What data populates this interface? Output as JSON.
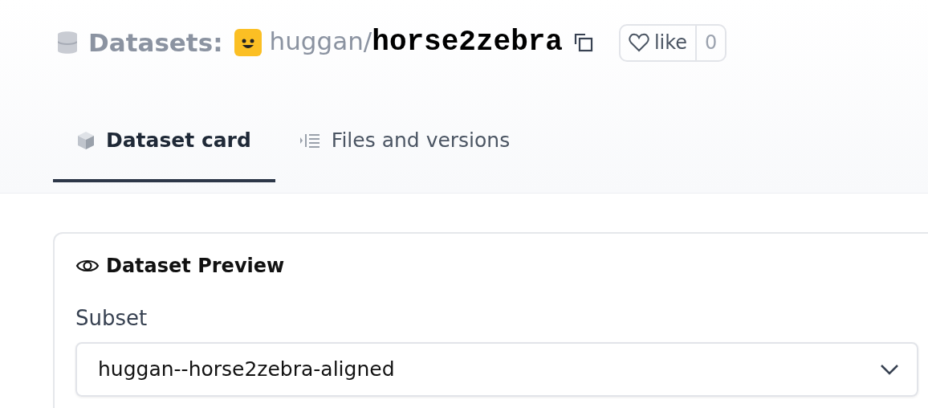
{
  "header": {
    "section": "Datasets:",
    "owner": "huggan",
    "separator": "/",
    "name": "horse2zebra",
    "like": {
      "label": "like",
      "count": "0",
      "liked": false
    }
  },
  "tabs": [
    {
      "label": "Dataset card",
      "kind": "card",
      "selected": true
    },
    {
      "label": "Files and versions",
      "kind": "files",
      "selected": false
    }
  ],
  "preview": {
    "title": "Dataset Preview",
    "subset_label": "Subset",
    "subset_value": "huggan--horse2zebra-aligned"
  }
}
